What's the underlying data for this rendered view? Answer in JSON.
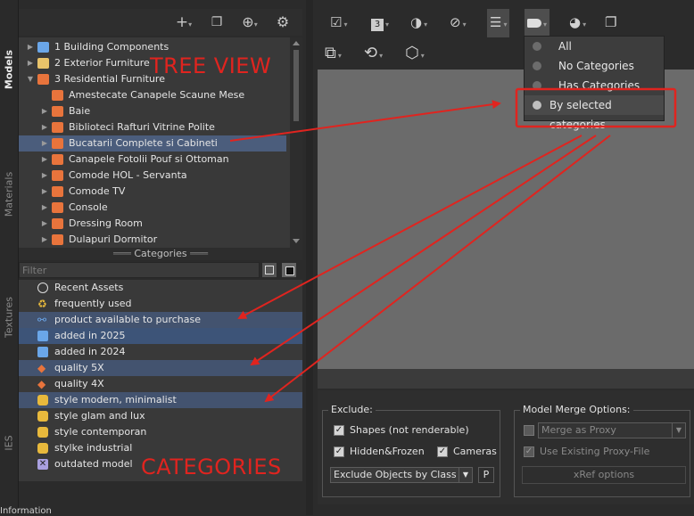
{
  "vertical_tabs": [
    {
      "label": "Models",
      "active": true
    },
    {
      "label": "Materials",
      "active": false
    },
    {
      "label": "Textures",
      "active": false
    },
    {
      "label": "IES",
      "active": false
    }
  ],
  "tree": {
    "items": [
      {
        "label": "1 Building Components",
        "icon": "box-icon",
        "color": "#6aa6e8",
        "expanded": false
      },
      {
        "label": "2 Exterior Furniture",
        "icon": "house-icon",
        "color": "#e8c36a",
        "expanded": false
      },
      {
        "label": "3 Residential Furniture",
        "icon": "sofa-icon",
        "color": "#e8743c",
        "expanded": true
      },
      {
        "label": "Amestecate Canapele Scaune Mese",
        "icon": "table-icon",
        "color": "#e8743c"
      },
      {
        "label": "Baie",
        "icon": "bath-icon",
        "color": "#e8743c"
      },
      {
        "label": "Biblioteci Rafturi Vitrine Polite",
        "icon": "shelf-icon",
        "color": "#e8743c"
      },
      {
        "label": "Bucatarii Complete si Cabineti",
        "icon": "cabinet-icon",
        "color": "#e8743c",
        "selected": true
      },
      {
        "label": "Canapele Fotolii Pouf si Ottoman",
        "icon": "sofa-icon",
        "color": "#e8743c"
      },
      {
        "label": "Comode HOL - Servanta",
        "icon": "drawer-icon",
        "color": "#e8743c"
      },
      {
        "label": "Comode TV",
        "icon": "tv-stand-icon",
        "color": "#e8743c"
      },
      {
        "label": "Console",
        "icon": "console-icon",
        "color": "#e8743c"
      },
      {
        "label": "Dressing Room",
        "icon": "wardrobe-icon",
        "color": "#e8743c"
      },
      {
        "label": "Dulapuri Dormitor",
        "icon": "wardrobe-icon",
        "color": "#e8743c"
      }
    ]
  },
  "categories_header": "Categories",
  "filter_placeholder": "Filter",
  "categories": [
    {
      "label": "Recent Assets",
      "icon": "clock-icon",
      "color": "#dddddd"
    },
    {
      "label": "frequently used",
      "icon": "recycle-icon",
      "color": "#e8b93c"
    },
    {
      "label": "product available to purchase",
      "icon": "share-icon",
      "color": "#6aa6e8",
      "highlight": true
    },
    {
      "label": "added in 2025",
      "icon": "calendar-icon",
      "color": "#6aa6e8",
      "highlight": "strong"
    },
    {
      "label": "added in 2024",
      "icon": "calendar-icon",
      "color": "#6aa6e8"
    },
    {
      "label": "quality 5X",
      "icon": "diamond-icon",
      "color": "#e8743c",
      "highlight": true
    },
    {
      "label": "quality 4X",
      "icon": "diamond-icon",
      "color": "#e8743c"
    },
    {
      "label": "style modern, minimalist",
      "icon": "sofa-icon",
      "color": "#e8b93c",
      "highlight": true
    },
    {
      "label": "style glam and lux",
      "icon": "sofa-icon",
      "color": "#e8b93c"
    },
    {
      "label": "style contemporan",
      "icon": "sofa-icon",
      "color": "#e8b93c"
    },
    {
      "label": "stylke industrial",
      "icon": "sofa-icon",
      "color": "#e8b93c"
    },
    {
      "label": "outdated model",
      "icon": "x-box-icon",
      "color": "#a9a0e0"
    }
  ],
  "category_filter_menu": {
    "items": [
      {
        "label": "All",
        "selected": false
      },
      {
        "label": "No Categories",
        "selected": false
      },
      {
        "label": "Has Categories",
        "selected": false
      },
      {
        "label": "By selected categories",
        "selected": true
      }
    ]
  },
  "exclude_group": {
    "title": "Exclude:",
    "shapes": {
      "label": "Shapes (not renderable)",
      "checked": true
    },
    "hidden_frozen": {
      "label": "Hidden&Frozen",
      "checked": true
    },
    "cameras": {
      "label": "Cameras",
      "checked": true
    },
    "mode_value": "Exclude Objects by Class",
    "p_button": "P"
  },
  "merge_group": {
    "title": "Model Merge Options:",
    "merge_as_proxy": {
      "label": "Merge as Proxy",
      "checked": false
    },
    "use_existing_proxy": {
      "label": "Use Existing Proxy-File",
      "checked": true
    },
    "xref_button": "xRef options"
  },
  "annotations": {
    "tree_view": "TREE VIEW",
    "categories": "CATEGORIES",
    "color": "#e0241f"
  },
  "status_text": "Information"
}
